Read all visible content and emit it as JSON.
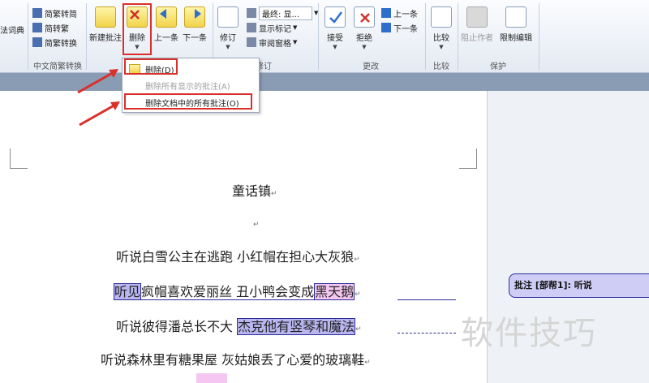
{
  "ribbon": {
    "dictionary_label": "法词典",
    "trad_to_simp": "简繁转简",
    "simp_to_trad": "简转繁",
    "simp_trad_convert": "简繁转换",
    "group_chinese": "中文简繁转换",
    "new_comment": "新建批注",
    "delete": "删除",
    "prev": "上一条",
    "next": "下一条",
    "track_changes": "修订",
    "final_display": "最终: 显...",
    "show_markup": "显示标记",
    "review_pane": "审阅窗格",
    "group_tracking": "修订",
    "accept": "接受",
    "reject": "拒绝",
    "prev_change": "上一条",
    "next_change": "下一条",
    "group_changes": "更改",
    "compare": "比较",
    "group_compare": "比较",
    "block_authors": "阻止作者",
    "restrict_editing": "限制编辑",
    "group_protect": "保护"
  },
  "menu": {
    "item1": "删除(D)",
    "item2": "删除所有显示的批注(A)",
    "item3": "删除文档中的所有批注(O)"
  },
  "document": {
    "title": "童话镇",
    "l1": "听说白雪公主在逃跑  小红帽在担心大灰狼",
    "l2a": "听见",
    "l2b": "疯帽喜欢爱丽丝  丑小鸭会变成",
    "l2c": "黑天鹅",
    "l3a": "听说彼得潘总长不大  ",
    "l3b": "杰克他有竖琴和魔法",
    "l4": "听说森林里有糖果屋  灰姑娘丢了心爱的玻璃鞋"
  },
  "comment": {
    "label": "批注 [部帮1]: 听说"
  },
  "watermark": "软件技巧"
}
